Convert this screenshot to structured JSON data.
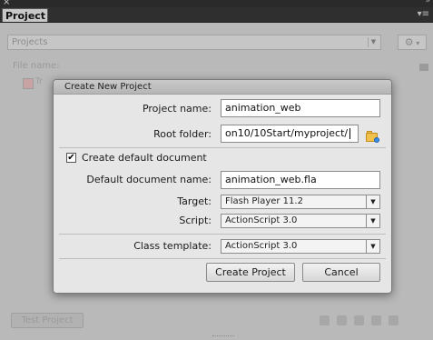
{
  "panel": {
    "tab_label": "Project",
    "projects_dropdown": "Projects",
    "file_name_label": "File name:",
    "bg_item_label": "Tr",
    "test_project_button": "Test Project",
    "close_glyph": "×",
    "collapse_glyph": "»",
    "panel_menu_glyph": "▾≡",
    "dropdown_arrow_glyph": "▼",
    "gear_glyph": "⚙"
  },
  "dialog": {
    "title": "Create New Project",
    "project_name_label": "Project name:",
    "project_name_value": "animation_web",
    "root_folder_label": "Root folder:",
    "root_folder_value": "οn10/10Start/myproject/",
    "create_default_doc_label": "Create default document",
    "create_default_doc_checked": true,
    "check_glyph": "✔",
    "default_doc_name_label": "Default document name:",
    "default_doc_name_value": "animation_web.fla",
    "target_label": "Target:",
    "target_value": "Flash Player 11.2",
    "script_label": "Script:",
    "script_value": "ActionScript 3.0",
    "class_template_label": "Class template:",
    "class_template_value": "ActionScript 3.0",
    "dropdown_glyph": "▼",
    "create_button": "Create Project",
    "cancel_button": "Cancel"
  },
  "colors": {
    "panel_bg": "#b9b9b9",
    "dialog_bg": "#e6e6e6",
    "titlebar_bg": "#2a2a2a",
    "folder_icon": "#f2c14b"
  }
}
